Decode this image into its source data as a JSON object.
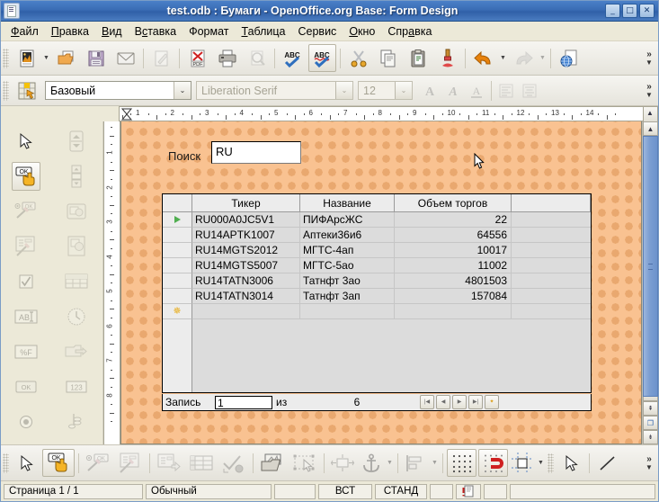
{
  "window": {
    "title": "test.odb : Бумаги - OpenOffice.org Base: Form Design",
    "minimize": "_",
    "maximize": "□",
    "close": "✕",
    "icon": "document-icon"
  },
  "menu": [
    {
      "label": "Файл"
    },
    {
      "label": "Правка"
    },
    {
      "label": "Вид"
    },
    {
      "label": "Вставка"
    },
    {
      "label": "Формат"
    },
    {
      "label": "Таблица"
    },
    {
      "label": "Сервис"
    },
    {
      "label": "Окно"
    },
    {
      "label": "Справка"
    }
  ],
  "toolbar_main": {
    "overflow": "»",
    "items": [
      {
        "name": "new-document",
        "icon": "new-doc-icon",
        "enabled": true,
        "dropdown": true
      },
      {
        "name": "open",
        "icon": "open-folder-icon",
        "enabled": true
      },
      {
        "name": "save",
        "icon": "floppy-save-icon",
        "enabled": true
      },
      {
        "name": "email",
        "icon": "envelope-icon",
        "enabled": true
      },
      {
        "name": "edit-file",
        "icon": "pencil-document-icon",
        "enabled": false
      },
      {
        "name": "export-pdf",
        "icon": "pdf-icon",
        "enabled": true
      },
      {
        "name": "print",
        "icon": "printer-icon",
        "enabled": true
      },
      {
        "name": "print-preview",
        "icon": "magnifier-page-icon",
        "enabled": false
      },
      {
        "name": "spelling",
        "icon": "abc-check-icon",
        "enabled": true
      },
      {
        "name": "autospellcheck",
        "icon": "abc-redline-icon",
        "enabled": true,
        "pressed": true
      },
      {
        "name": "cut",
        "icon": "scissors-icon",
        "enabled": true
      },
      {
        "name": "copy",
        "icon": "copy-pages-icon",
        "enabled": true
      },
      {
        "name": "paste",
        "icon": "clipboard-icon",
        "enabled": true
      },
      {
        "name": "clone-formatting",
        "icon": "paintbrush-icon",
        "enabled": true
      },
      {
        "name": "undo",
        "icon": "undo-arrow-icon",
        "enabled": true,
        "dropdown": true
      },
      {
        "name": "redo",
        "icon": "redo-arrow-icon",
        "enabled": false,
        "dropdown": true
      },
      {
        "name": "hyperlink",
        "icon": "globe-page-icon",
        "enabled": true
      }
    ]
  },
  "toolbar_format": {
    "overflow": "»",
    "control_props_icon": "control-properties-icon",
    "paragraph_style": {
      "value": "Базовый",
      "arrow": "⌄"
    },
    "font_name": {
      "value": "Liberation Serif",
      "arrow": "⌄",
      "disabled": true
    },
    "font_size": {
      "value": "12",
      "arrow": "⌄",
      "disabled": true
    },
    "buttons": [
      {
        "name": "bold",
        "glyph": "A",
        "disabled": true
      },
      {
        "name": "italic",
        "glyph": "A",
        "disabled": true
      },
      {
        "name": "underline",
        "glyph": "A",
        "disabled": true
      },
      {
        "name": "align-left",
        "glyph": "≡",
        "disabled": true
      },
      {
        "name": "align-center",
        "glyph": "≡",
        "disabled": true
      }
    ]
  },
  "rulers": {
    "horizontal": [
      "1",
      "2",
      "3",
      "4",
      "5",
      "6",
      "7",
      "8",
      "9",
      "10",
      "11",
      "12",
      "13",
      "14"
    ],
    "vertical": [
      "1",
      "2",
      "3",
      "4",
      "5",
      "6",
      "7",
      "8"
    ]
  },
  "left_toolbar": {
    "column_a": [
      {
        "name": "select-pointer",
        "icon": "arrow-pointer-icon",
        "enabled": true
      },
      {
        "name": "design-mode-toggle",
        "icon": "ok-hand-icon",
        "enabled": true,
        "pressed": true
      },
      {
        "name": "control-wizards",
        "icon": "wizard-wand-ok-icon",
        "enabled": false
      },
      {
        "name": "form-wizard",
        "icon": "form-wizard-icon",
        "enabled": false
      },
      {
        "name": "check-box",
        "icon": "checkbox-icon",
        "enabled": false
      },
      {
        "name": "text-box",
        "icon": "abc-textbox-icon",
        "enabled": false
      },
      {
        "name": "formatted-field",
        "icon": "percent-f-icon",
        "enabled": false
      },
      {
        "name": "push-button",
        "icon": "ok-button-icon",
        "enabled": false
      },
      {
        "name": "option-button",
        "icon": "radio-button-icon",
        "enabled": false
      }
    ],
    "column_b": [
      {
        "name": "spin-button",
        "icon": "spin-button-icon",
        "enabled": false
      },
      {
        "name": "scroll-bar",
        "icon": "scrollbar-icon",
        "enabled": false
      },
      {
        "name": "image-button",
        "icon": "image-button-icon",
        "enabled": false
      },
      {
        "name": "image-control",
        "icon": "image-control-icon",
        "enabled": false
      },
      {
        "name": "table-control",
        "icon": "table-control-icon",
        "enabled": false
      },
      {
        "name": "date-time-field",
        "icon": "clock-icon",
        "enabled": false
      },
      {
        "name": "file-selection",
        "icon": "file-selection-icon",
        "enabled": false
      },
      {
        "name": "numeric-field",
        "icon": "123-numeric-icon",
        "enabled": false
      },
      {
        "name": "currency-field",
        "icon": "coins-currency-icon",
        "enabled": false
      }
    ],
    "more_icon": "more-controls-icon",
    "expand_icon": "expand-arrow-icon"
  },
  "form": {
    "search_label": "Поиск",
    "search_value": "RU",
    "grid": {
      "columns": [
        "Тикер",
        "Название",
        "Объем торгов",
        ""
      ],
      "rows": [
        {
          "marker": "current",
          "cells": [
            "RU000A0JC5V1",
            "ПИФАрсЖС",
            "22",
            ""
          ]
        },
        {
          "marker": "",
          "cells": [
            "RU14APTK1007",
            "Аптеки36и6",
            "64556",
            ""
          ]
        },
        {
          "marker": "",
          "cells": [
            "RU14MGTS2012",
            "МГТС-4ап",
            "10017",
            ""
          ]
        },
        {
          "marker": "",
          "cells": [
            "RU14MGTS5007",
            "МГТС-5ао",
            "11002",
            ""
          ]
        },
        {
          "marker": "",
          "cells": [
            "RU14TATN3006",
            "Татнфт 3ао",
            "4801503",
            ""
          ]
        },
        {
          "marker": "",
          "cells": [
            "RU14TATN3014",
            "Татнфт 3ап",
            "157084",
            ""
          ]
        },
        {
          "marker": "new",
          "cells": [
            "",
            "",
            "",
            ""
          ]
        }
      ]
    },
    "navigation": {
      "record_label": "Запись",
      "record_value": "1",
      "of_label": "из",
      "count": "6",
      "buttons": [
        {
          "name": "first-record",
          "glyph": "|◀"
        },
        {
          "name": "previous-record",
          "glyph": "◀"
        },
        {
          "name": "next-record",
          "glyph": "▶"
        },
        {
          "name": "last-record",
          "glyph": "▶|"
        },
        {
          "name": "new-record",
          "glyph": "✦"
        }
      ]
    }
  },
  "bottom_toolbar": {
    "overflow": "»",
    "items": [
      {
        "name": "select-pointer",
        "icon": "arrow-pointer-icon"
      },
      {
        "name": "design-mode",
        "icon": "ok-hand-icon",
        "pressed": true
      },
      {
        "name": "control-wizards",
        "icon": "wizard-wand-ok-icon",
        "disabled": true
      },
      {
        "name": "form-wizard",
        "icon": "form-wizard-icon",
        "disabled": true
      },
      {
        "name": "form-navigator",
        "icon": "form-navigator-icon",
        "disabled": true
      },
      {
        "name": "table-control-bar",
        "icon": "table-grid-icon",
        "disabled": true
      },
      {
        "name": "activation-order",
        "icon": "activation-order-icon",
        "disabled": true
      },
      {
        "name": "open-in-design-mode",
        "icon": "open-design-icon"
      },
      {
        "name": "automatic-control-focus",
        "icon": "control-focus-icon",
        "disabled": true
      },
      {
        "name": "position-size",
        "icon": "position-size-icon",
        "disabled": true
      },
      {
        "name": "anchor",
        "icon": "anchor-icon",
        "dropdown": true
      },
      {
        "name": "align",
        "icon": "align-objects-icon",
        "dropdown": true
      },
      {
        "name": "display-grid",
        "icon": "grid-dots-icon",
        "pressed": true
      },
      {
        "name": "snap-to-grid",
        "icon": "magnet-icon",
        "pressed": true
      },
      {
        "name": "helplines-while-moving",
        "icon": "helplines-icon",
        "dropdown": true
      },
      {
        "name": "select-tool",
        "icon": "arrow-pointer-icon"
      },
      {
        "name": "line",
        "icon": "line-icon"
      }
    ]
  },
  "statusbar": {
    "page": "Страница  1 / 1",
    "style": "Обычный",
    "blank1": "",
    "insert_mode": "ВСТ",
    "selection_mode": "СТАНД",
    "blank2": "",
    "modified_icon": "document-modified-icon",
    "blank3": "",
    "blank4": ""
  }
}
